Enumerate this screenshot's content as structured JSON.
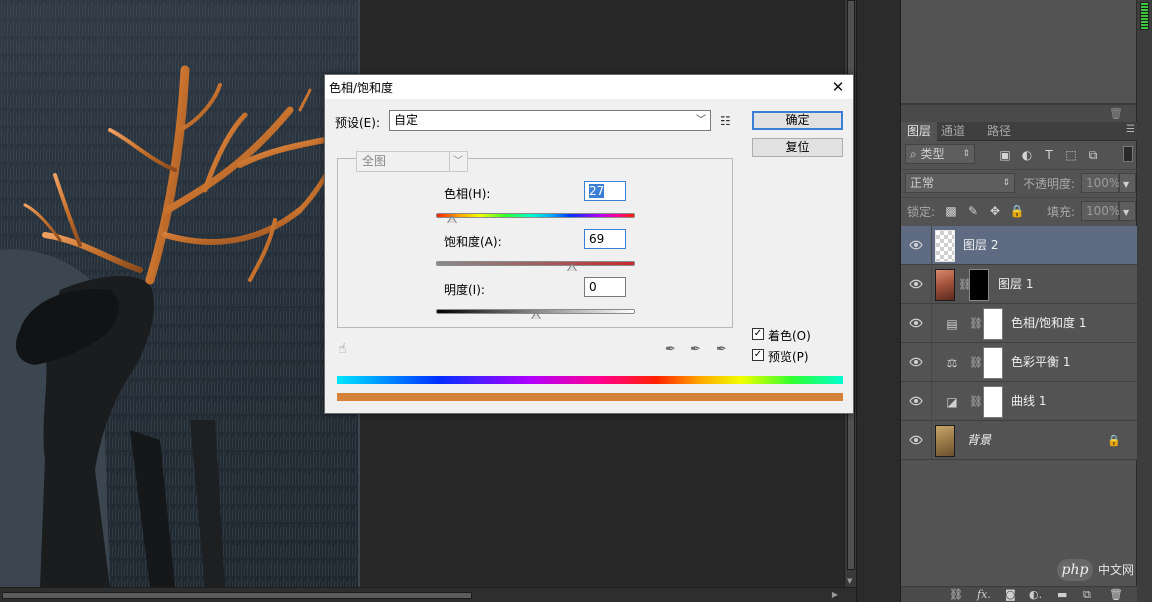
{
  "dialog": {
    "title": "色相/饱和度",
    "preset_label": "预设(E):",
    "preset_value": "自定",
    "ok_label": "确定",
    "reset_label": "复位",
    "channel_value": "全图",
    "hue_label": "色相(H):",
    "hue_value": "27",
    "saturation_label": "饱和度(A):",
    "saturation_value": "69",
    "lightness_label": "明度(I):",
    "lightness_value": "0",
    "colorize_label": "着色(O)",
    "colorize_checked": true,
    "preview_label": "预览(P)",
    "preview_checked": true,
    "hue_level": 0.08,
    "saturation_level": 0.685,
    "lightness_level": 0.5,
    "colors": {
      "preview_bar": "#d4823a",
      "hue_gradient": "#ff2000",
      "sat_end": "#c8292f"
    }
  },
  "layers_panel": {
    "tabs": [
      "图层",
      "通道",
      "路径"
    ],
    "filter_label": "类型",
    "blend_mode": "正常",
    "opacity_label": "不透明度:",
    "opacity_value": "100%",
    "lock_label": "锁定:",
    "fill_label": "填充:",
    "fill_value": "100%",
    "layers": [
      {
        "name": "图层 2",
        "selected": true
      },
      {
        "name": "图层 1"
      },
      {
        "name": "色相/饱和度 1"
      },
      {
        "name": "色彩平衡 1"
      },
      {
        "name": "曲线 1"
      },
      {
        "name": "背景"
      }
    ]
  },
  "watermark": {
    "logo_text": "php",
    "site_text": "中文网"
  }
}
